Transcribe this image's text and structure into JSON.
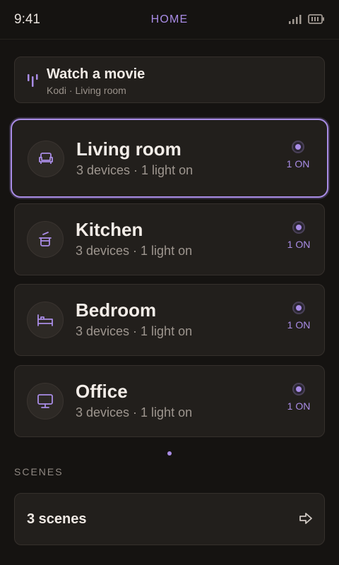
{
  "status_bar": {
    "time": "9:41",
    "title": "HOME"
  },
  "activity": {
    "title": "Watch a movie",
    "subtitle": "Kodi · Living room",
    "icon": "equalizer-icon"
  },
  "rooms": [
    {
      "name": "Living room",
      "subtitle": "3 devices · 1 light on",
      "status": "1 ON",
      "icon": "sofa-icon",
      "selected": true
    },
    {
      "name": "Kitchen",
      "subtitle": "3 devices · 1 light on",
      "status": "1 ON",
      "icon": "cooking-pot-icon",
      "selected": false
    },
    {
      "name": "Bedroom",
      "subtitle": "3 devices · 1 light on",
      "status": "1 ON",
      "icon": "bed-icon",
      "selected": false
    },
    {
      "name": "Office",
      "subtitle": "3 devices · 1 light on",
      "status": "1 ON",
      "icon": "monitor-icon",
      "selected": false
    }
  ],
  "scenes": {
    "section_label": "SCENES",
    "label": "3 scenes",
    "icon": "arrow-right-icon"
  },
  "colors": {
    "accent": "#a98ce6",
    "background": "#151311",
    "card": "#221f1c"
  }
}
